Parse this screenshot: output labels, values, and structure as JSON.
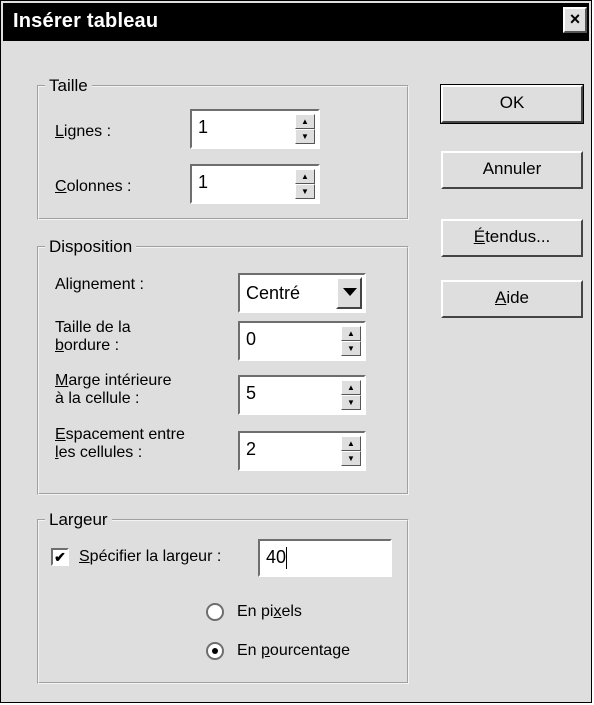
{
  "window": {
    "title": "Insérer tableau",
    "close_label": "×"
  },
  "taille": {
    "legend": "Taille",
    "lignes_pre": "",
    "lignes_u": "L",
    "lignes_post": "ignes :",
    "lignes_value": "1",
    "colonnes_pre": "",
    "colonnes_u": "C",
    "colonnes_post": "olonnes :",
    "colonnes_value": "1"
  },
  "disposition": {
    "legend": "Disposition",
    "alignement_label": "Alignement :",
    "alignement_value": "Centré",
    "bordure_line1": "Taille de la",
    "bordure_u": "b",
    "bordure_post": "ordure :",
    "bordure_value": "0",
    "marge_u": "M",
    "marge_post": "arge intérieure",
    "marge_line2": "à la cellule :",
    "marge_value": "5",
    "espacement_u": "E",
    "espacement_post": "spacement entre",
    "espacement_line2_u": "l",
    "espacement_line2_post": "es cellules :",
    "espacement_value": "2"
  },
  "largeur": {
    "legend": "Largeur",
    "specifier_u": "S",
    "specifier_post": "pécifier la largeur :",
    "specifier_checked": "✔",
    "width_value": "40",
    "pixels_pre": "En pi",
    "pixels_u": "x",
    "pixels_post": "els",
    "pourcentage_pre": "En ",
    "pourcentage_u": "p",
    "pourcentage_post": "ourcentage"
  },
  "buttons": {
    "ok": "OK",
    "annuler": "Annuler",
    "etendus_u": "É",
    "etendus_post": "tendus...",
    "aide_u": "A",
    "aide_post": "ide"
  }
}
